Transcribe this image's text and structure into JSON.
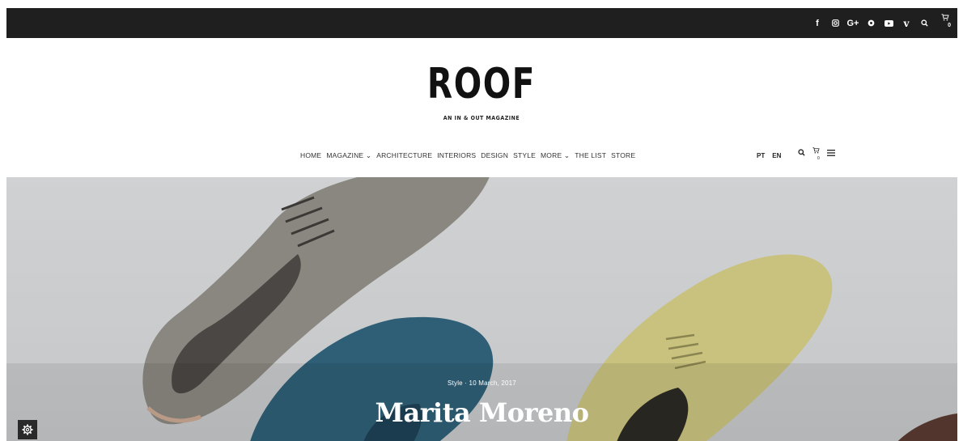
{
  "topbar": {
    "social_icons": [
      {
        "name": "facebook-icon",
        "glyph": "f"
      },
      {
        "name": "instagram-icon",
        "glyph": "◎"
      },
      {
        "name": "google-plus-icon",
        "glyph": "G+"
      },
      {
        "name": "pinterest-icon",
        "glyph": "⊛"
      },
      {
        "name": "youtube-icon",
        "glyph": "▶"
      },
      {
        "name": "vimeo-icon",
        "glyph": "v"
      }
    ],
    "cart_count": "0",
    "colors": {
      "background": "#1f1f1f",
      "icon": "#ffffff"
    }
  },
  "logo": {
    "wordmark": "ROOF",
    "tagline": "AN IN & OUT MAGAZINE"
  },
  "nav": {
    "items": [
      {
        "label": "HOME"
      },
      {
        "label": "MAGAZINE ⌄"
      },
      {
        "label": "ARCHITECTURE"
      },
      {
        "label": "INTERIORS"
      },
      {
        "label": "DESIGN"
      },
      {
        "label": "STYLE"
      },
      {
        "label": "MORE ⌄"
      },
      {
        "label": "THE LIST"
      },
      {
        "label": "STORE"
      }
    ],
    "languages": [
      "PT",
      "EN"
    ],
    "cart_count": "0"
  },
  "hero": {
    "meta": "Style  ·  10 March, 2017",
    "title": "Marita Moreno"
  }
}
